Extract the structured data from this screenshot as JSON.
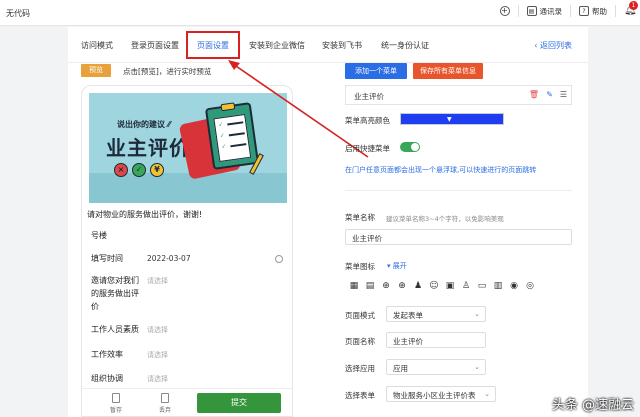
{
  "app": {
    "name": "无代码"
  },
  "topbar": {
    "contacts_label": "通讯录",
    "help_label": "帮助",
    "notification_count": "1"
  },
  "tabs": [
    {
      "label": "访问模式"
    },
    {
      "label": "登录页面设置"
    },
    {
      "label": "页面设置"
    },
    {
      "label": "安装到企业微信"
    },
    {
      "label": "安装到飞书"
    },
    {
      "label": "统一身份认证"
    }
  ],
  "back_link": "返回列表",
  "preview": {
    "button_label": "预览",
    "hint": "点击[预览]，进行实时预览",
    "banner_subtitle": "说出你的建议",
    "banner_title": "业主评价",
    "emoji": [
      "×",
      "✓",
      "¥"
    ],
    "form_intro": "请对物业的服务做出评价，谢谢!",
    "fields": [
      {
        "label": "号楼",
        "value": "",
        "placeholder": ""
      },
      {
        "label": "填写时间",
        "value": "2022-03-07",
        "placeholder": ""
      },
      {
        "label": "邀请您对我们的服务做出评价",
        "value": "",
        "placeholder": "请选择"
      },
      {
        "label": "工作人员素质",
        "value": "",
        "placeholder": "请选择"
      },
      {
        "label": "工作效率",
        "value": "",
        "placeholder": "请选择"
      },
      {
        "label": "组织协调",
        "value": "",
        "placeholder": "请选择"
      }
    ],
    "footer": {
      "save_label": "暂存",
      "discard_label": "丢弃",
      "submit_label": "提交"
    }
  },
  "panel": {
    "add_menu_label": "添加一个菜单",
    "save_all_label": "保存所有菜单信息",
    "menu_item": "业主评价",
    "highlight_color_label": "菜单高亮颜色",
    "highlight_color": "#1f3ef2",
    "quick_menu_label": "启用快捷菜单",
    "quick_menu_enabled": true,
    "quick_menu_hint": "在门户任意页面都会出现一个悬浮球,可以快速进行的页面跳转",
    "menu_name_label": "菜单名称",
    "menu_name_hint": "建议菜单名称3~4个字符，以免影响美观",
    "menu_name_value": "业主评价",
    "menu_icon_label": "菜单图标",
    "expand_label": "展开",
    "icons": [
      "calendar-icon",
      "list-icon",
      "plus-circle-icon",
      "add-circle-icon",
      "user-add-icon",
      "group-icon",
      "contact-icon",
      "user-edit-icon",
      "card-icon",
      "form-icon",
      "eye-icon",
      "view-icon"
    ],
    "page_mode_label": "页面模式",
    "page_mode_value": "发起表单",
    "page_name_label": "页面名称",
    "page_name_value": "业主评价",
    "select_app_label": "选择应用",
    "select_app_value": "应用",
    "select_form_label": "选择表单",
    "select_form_value": "物业服务小区业主评价表"
  },
  "watermark": "头条 @速融云"
}
